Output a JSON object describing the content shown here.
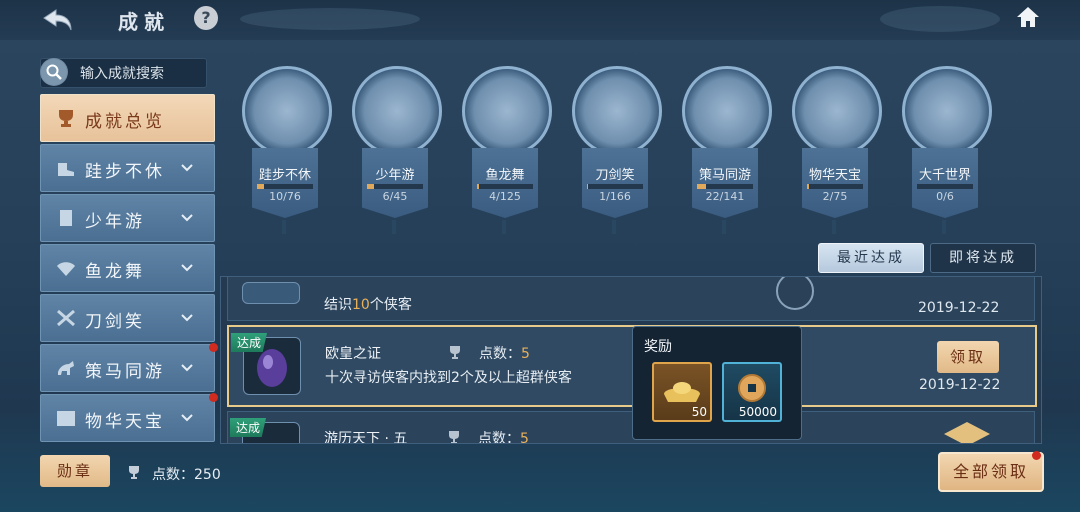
{
  "header": {
    "title": "成就",
    "help": "?"
  },
  "search": {
    "placeholder": "输入成就搜索"
  },
  "sidebar": {
    "items": [
      {
        "label": "成就总览",
        "icon": "trophy-icon",
        "active": true,
        "dot": false
      },
      {
        "label": "跬步不休",
        "icon": "boot-icon",
        "active": false,
        "dot": false
      },
      {
        "label": "少年游",
        "icon": "book-icon",
        "active": false,
        "dot": false
      },
      {
        "label": "鱼龙舞",
        "icon": "fan-icon",
        "active": false,
        "dot": false
      },
      {
        "label": "刀剑笑",
        "icon": "swords-icon",
        "active": false,
        "dot": false
      },
      {
        "label": "策马同游",
        "icon": "horse-icon",
        "active": false,
        "dot": true
      },
      {
        "label": "物华天宝",
        "icon": "chest-icon",
        "active": false,
        "dot": true
      }
    ]
  },
  "categories": [
    {
      "label": "跬步不休",
      "count": "10/76",
      "progress": 0.13,
      "icon": "scroll-fabric-icon"
    },
    {
      "label": "少年游",
      "count": "6/45",
      "progress": 0.13,
      "icon": "purple-book-icon"
    },
    {
      "label": "鱼龙舞",
      "count": "4/125",
      "progress": 0.03,
      "icon": "fan-ribbon-icon"
    },
    {
      "label": "刀剑笑",
      "count": "1/166",
      "progress": 0.01,
      "icon": "crossed-swords-icon"
    },
    {
      "label": "策马同游",
      "count": "22/141",
      "progress": 0.16,
      "icon": "horse-icon"
    },
    {
      "label": "物华天宝",
      "count": "2/75",
      "progress": 0.03,
      "icon": "treasure-chest-icon"
    },
    {
      "label": "大千世界",
      "count": "0/6",
      "progress": 0.0,
      "icon": "map-scroll-icon"
    }
  ],
  "filters": {
    "recent": "最近达成",
    "upcoming": "即将达成"
  },
  "achievements": [
    {
      "tag": "",
      "name": "",
      "desc_pre": "结识",
      "desc_num": "10",
      "desc_post": "个侠客",
      "points": "",
      "date": "2019-12-22",
      "claim": ""
    },
    {
      "tag": "达成",
      "name": "欧皇之证",
      "points_label": "点数：",
      "points": "5",
      "desc": "十次寻访侠客内找到2个及以上超群侠客",
      "date": "2019-12-22",
      "claim": "领取"
    },
    {
      "tag": "达成",
      "name": "游历天下 · 五",
      "points_label": "点数：",
      "points": "5"
    }
  ],
  "reward_popup": {
    "title": "奖励",
    "items": [
      {
        "icon": "gold-ingot-icon",
        "amount": "50"
      },
      {
        "icon": "copper-coin-icon",
        "amount": "50000"
      }
    ]
  },
  "footer": {
    "medal": "勋章",
    "points_label": "点数：",
    "points": "250",
    "claim_all": "全部领取"
  },
  "colors": {
    "accent": "#e1b987",
    "highlight_border": "#e8cb8a",
    "tag_green": "#2fa07a",
    "alert_dot": "#d12a1e"
  }
}
